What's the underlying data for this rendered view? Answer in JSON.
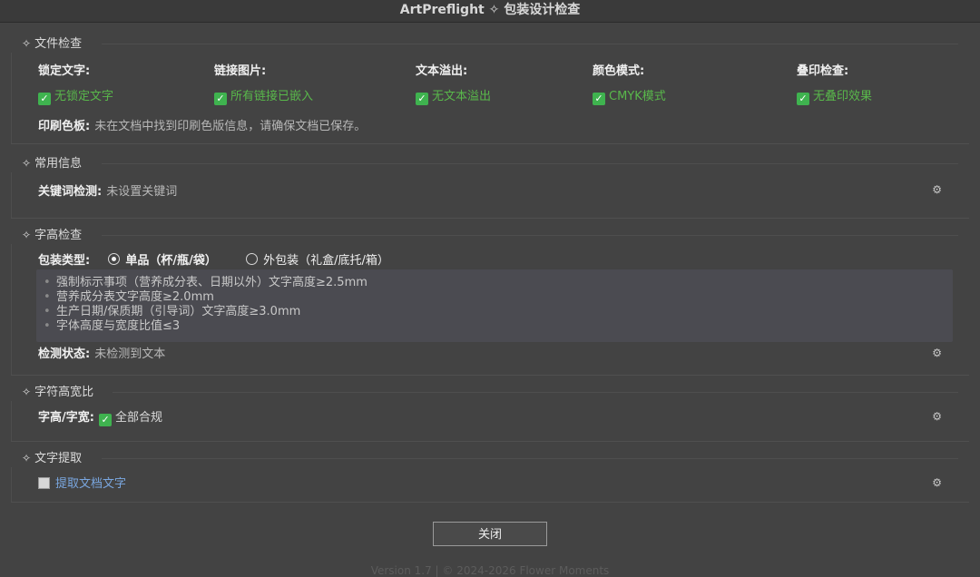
{
  "window": {
    "title": "ArtPreflight ✧ 包装设计检查"
  },
  "file_check": {
    "title": "文件检查",
    "columns": [
      {
        "label": "锁定文字:",
        "status": "无锁定文字"
      },
      {
        "label": "链接图片:",
        "status": "所有链接已嵌入"
      },
      {
        "label": "文本溢出:",
        "status": "无文本溢出"
      },
      {
        "label": "颜色模式:",
        "status": "CMYK模式"
      },
      {
        "label": "叠印检查:",
        "status": "无叠印效果"
      }
    ],
    "plate_label": "印刷色板:",
    "plate_value": "未在文档中找到印刷色版信息，请确保文档已保存。"
  },
  "common_info": {
    "title": "常用信息",
    "keyword_label": "关键词检测:",
    "keyword_value": "未设置关键词"
  },
  "text_height": {
    "title": "字高检查",
    "package_label": "包装类型:",
    "options": [
      "单品（杯/瓶/袋）",
      "外包装（礼盒/底托/箱）"
    ],
    "selected_option": "单品（杯/瓶/袋）",
    "requirements": [
      "强制标示事项（营养成分表、日期以外）文字高度≥2.5mm",
      "营养成分表文字高度≥2.0mm",
      "生产日期/保质期（引导词）文字高度≥3.0mm",
      "字体高度与宽度比值≤3"
    ],
    "status_label": "检测状态:",
    "status_value": "未检测到文本"
  },
  "char_ratio": {
    "title": "字符高宽比",
    "label": "字高/字宽:",
    "value": "全部合规"
  },
  "text_extract": {
    "title": "文字提取",
    "link_label": "提取文档文字"
  },
  "buttons": {
    "close": "关闭"
  },
  "footer": {
    "text": "Version 1.7  |  © 2024-2026 Flower Moments"
  },
  "icons": {
    "section": "diamond-sparkle-icon",
    "settings": "gear-icon",
    "check": "green-check-icon"
  },
  "colors": {
    "accent_green": "#59b84b",
    "link_blue": "#7aa7e0",
    "background": "#434343"
  }
}
